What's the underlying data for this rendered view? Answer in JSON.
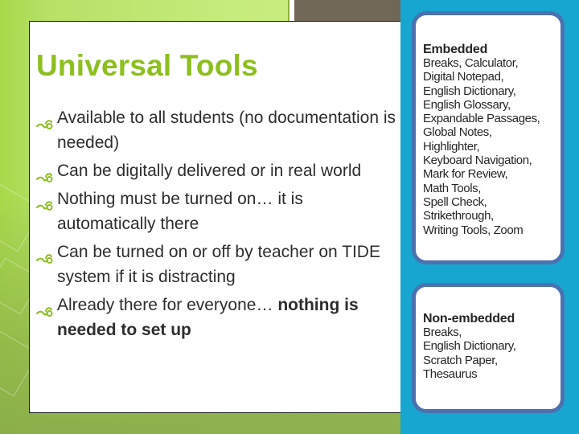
{
  "slide": {
    "title": "Universal Tools",
    "bullets": [
      {
        "text": "Available to all students (no documentation is needed)"
      },
      {
        "text": "Can be digitally delivered or in real world"
      },
      {
        "text": "Nothing must be turned on… it is automatically there"
      },
      {
        "text": "Can be turned on or off by teacher on TIDE system if it is distracting"
      },
      {
        "text": "Already there for everyone… ",
        "bold_text": "nothing is needed to set up"
      }
    ],
    "bullet_icon": "scroll-swirl-icon"
  },
  "panel": {
    "embedded": {
      "heading": "Embedded",
      "lines": [
        "Breaks, Calculator,",
        "Digital Notepad,",
        "English Dictionary,",
        "English Glossary,",
        "Expandable Passages,",
        "Global Notes,",
        "Highlighter,",
        "Keyboard Navigation,",
        "Mark for Review,",
        "Math Tools,",
        "Spell Check,",
        "Strikethrough,",
        "Writing Tools, Zoom"
      ]
    },
    "non_embedded": {
      "heading": "Non-embedded",
      "lines": [
        "Breaks,",
        "English Dictionary,",
        "Scratch Paper,",
        "Thesaurus"
      ]
    }
  },
  "colors": {
    "title_green": "#8dbf1f",
    "bullet_green": "#8dbf1f",
    "panel_blue": "#17a6d0",
    "card_border": "#4a72b0",
    "accent_taupe": "#716757"
  }
}
